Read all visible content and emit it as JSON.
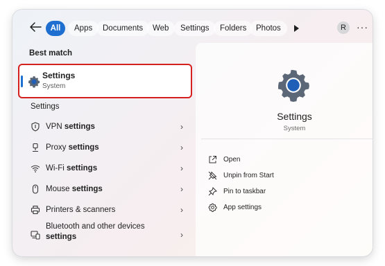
{
  "filters": {
    "tabs": [
      {
        "label": "All"
      },
      {
        "label": "Apps"
      },
      {
        "label": "Documents"
      },
      {
        "label": "Web"
      },
      {
        "label": "Settings"
      },
      {
        "label": "Folders"
      },
      {
        "label": "Photos"
      }
    ],
    "avatar_initial": "R",
    "more": "···"
  },
  "best_match": {
    "heading": "Best match",
    "title": "Settings",
    "subtitle": "System"
  },
  "settings_section": {
    "heading": "Settings",
    "items": [
      {
        "text": "VPN ",
        "bold": "settings",
        "icon": "vpn-shield-icon"
      },
      {
        "text": "Proxy ",
        "bold": "settings",
        "icon": "proxy-icon"
      },
      {
        "text": "Wi-Fi ",
        "bold": "settings",
        "icon": "wifi-icon"
      },
      {
        "text": "Mouse ",
        "bold": "settings",
        "icon": "mouse-icon"
      },
      {
        "text": "Printers & scanners",
        "bold": "",
        "icon": "printer-icon"
      },
      {
        "text": "Bluetooth and other devices",
        "bold": "settings",
        "icon": "bluetooth-devices-icon"
      }
    ]
  },
  "preview": {
    "title": "Settings",
    "subtitle": "System",
    "actions": [
      {
        "label": "Open",
        "icon": "open-icon"
      },
      {
        "label": "Unpin from Start",
        "icon": "unpin-icon"
      },
      {
        "label": "Pin to taskbar",
        "icon": "pin-icon"
      },
      {
        "label": "App settings",
        "icon": "gear-icon"
      }
    ]
  },
  "colors": {
    "accent": "#1f6fd1",
    "highlight_border": "#d62020"
  }
}
